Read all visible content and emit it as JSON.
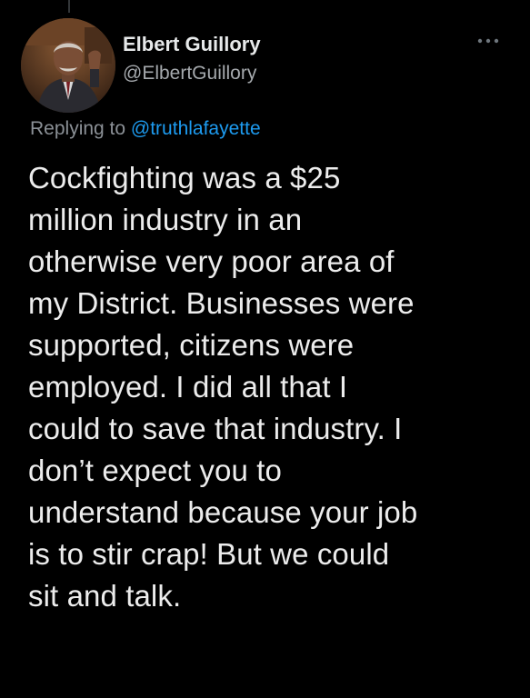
{
  "tweet": {
    "author": {
      "display_name": "Elbert Guillory",
      "handle": "@ElbertGuillory",
      "avatar_icon": "user-photo-avatar"
    },
    "replying_prefix": "Replying to ",
    "replying_to": "@truthlafayette",
    "text": "Cockfighting was a $25\nmillion industry in an\notherwise very poor area of\nmy District. Businesses were\nsupported, citizens were\nemployed. I did all that I\ncould to save that industry. I\ndon’t expect you to\nunderstand because your job\nis to stir crap!  But we could\nsit and talk.",
    "more_icon": "more-options-icon"
  },
  "colors": {
    "background": "#000000",
    "primary_text": "#e7e9ea",
    "secondary_text": "#8b9096",
    "link": "#1d9bf0"
  }
}
